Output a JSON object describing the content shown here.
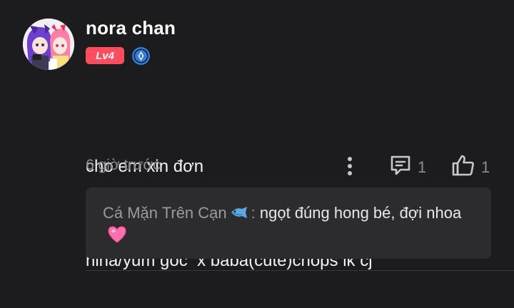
{
  "comment": {
    "user": {
      "name": "nora chan",
      "level": "Lv4",
      "rank_icon": "rank-diamond-icon",
      "avatar": "anime-avatar"
    },
    "lines": [
      "cho em xin đơn",
      "hiha/yum gốc  x baba(cute)chops ik cj"
    ],
    "time": "6 giờ trước",
    "reply_count": "1",
    "like_count": "1"
  },
  "reply": {
    "author": "Cá Mặn Trên Cạn",
    "separator": ":",
    "text": "ngọt đúng hong bé, đợi nhoa"
  },
  "colors": {
    "background": "#1c1c1e",
    "level_badge": "#ff4d5e",
    "rank_icon": "#2f7fe0",
    "reply_box": "#2c2c2e",
    "muted_text": "#8e8e93"
  }
}
